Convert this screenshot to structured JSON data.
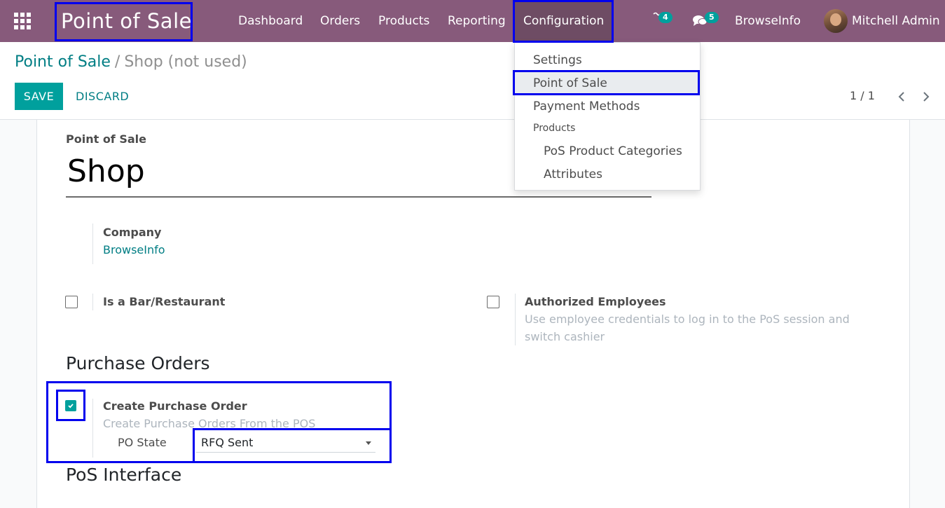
{
  "navbar": {
    "app_name": "Point of Sale",
    "menu": [
      "Dashboard",
      "Orders",
      "Products",
      "Reporting",
      "Configuration"
    ],
    "activity_count": "4",
    "message_count": "5",
    "company": "BrowseInfo",
    "user": "Mitchell Admin"
  },
  "breadcrumb": {
    "parent": "Point of Sale",
    "separator": "/",
    "current": "Shop (not used)"
  },
  "buttons": {
    "save": "SAVE",
    "discard": "DISCARD"
  },
  "pager": {
    "value": "1 / 1"
  },
  "form": {
    "name_label": "Point of Sale",
    "name_value": "Shop",
    "company_label": "Company",
    "company_value": "BrowseInfo",
    "bar_label": "Is a Bar/Restaurant",
    "bar_checked": false,
    "employees_label": "Authorized Employees",
    "employees_help_1": "Use employee credentials to log in to the PoS session and",
    "employees_help_2": "switch cashier",
    "employees_checked": false,
    "purchase_section": "Purchase Orders",
    "create_po_label": "Create Purchase Order",
    "create_po_help": "Create Purchase Orders From the POS",
    "create_po_checked": true,
    "po_state_label": "PO State",
    "po_state_value": "RFQ Sent",
    "interface_section": "PoS Interface"
  },
  "dropdown": {
    "items": [
      "Settings",
      "Point of Sale",
      "Payment Methods"
    ],
    "group_header": "Products",
    "sub_items": [
      "PoS Product Categories",
      "Attributes"
    ],
    "highlighted": "Point of Sale"
  },
  "colors": {
    "navbar": "#875a7b",
    "accent": "#00a09d",
    "link": "#017e84",
    "annotation": "#0000ee"
  }
}
